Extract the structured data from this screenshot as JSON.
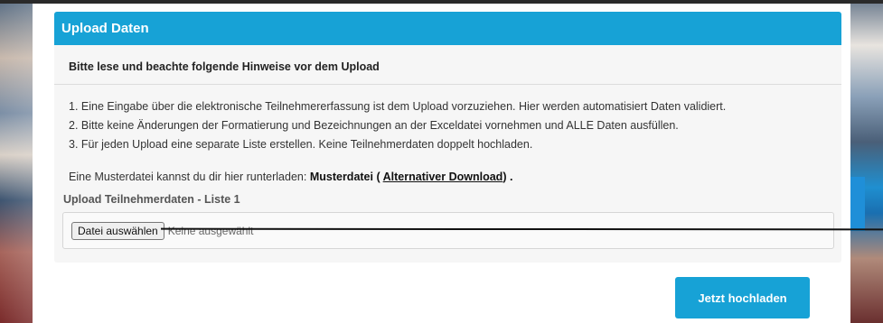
{
  "panel": {
    "title": "Upload Daten",
    "hint_title": "Bitte lese und beachte folgende Hinweise vor dem Upload",
    "hints": [
      "1. Eine Eingabe über die elektronische Teilnehmererfassung ist dem Upload vorzuziehen. Hier werden automatisiert Daten validiert.",
      "2. Bitte keine Änderungen der Formatierung und Bezeichnungen an der Exceldatei vornehmen und ALLE Daten ausfüllen.",
      "3. Für jeden Upload eine separate Liste erstellen. Keine Teilnehmerdaten doppelt hochladen."
    ],
    "muster_prefix": "Eine Musterdatei kannst du dir hier runterladen: ",
    "muster_link": "Musterdatei",
    "muster_paren_open": " ( ",
    "alt_download": "Alternativer Download",
    "muster_paren_close": ") .",
    "upload_label": "Upload Teilnehmerdaten - Liste 1",
    "file_button": "Datei auswählen",
    "file_status": "Keine ausgewählt"
  },
  "submit_label": "Jetzt hochladen",
  "colors": {
    "accent": "#17a2d6",
    "panel_bg": "#f6f6f6"
  }
}
